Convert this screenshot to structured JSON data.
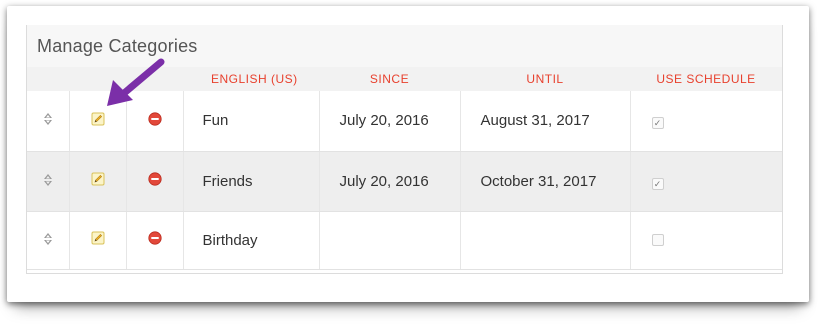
{
  "panel": {
    "title": "Manage Categories"
  },
  "columns": {
    "name": "ENGLISH (US)",
    "since": "SINCE",
    "until": "UNTIL",
    "use_schedule": "USE SCHEDULE"
  },
  "rows": [
    {
      "name": "Fun",
      "since": "July 20, 2016",
      "until": "August 31, 2017",
      "use_schedule": true
    },
    {
      "name": "Friends",
      "since": "July 20, 2016",
      "until": "October 31, 2017",
      "use_schedule": true
    },
    {
      "name": "Birthday",
      "since": "",
      "until": "",
      "use_schedule": false
    }
  ],
  "icons": {
    "sort": "sort-handle-icon",
    "edit": "pencil-icon",
    "delete": "remove-circle-icon",
    "check": "✓"
  },
  "colors": {
    "header_text": "#e8412e",
    "delete_icon": "#e2483a",
    "annotation_arrow": "#7b2fa8"
  }
}
